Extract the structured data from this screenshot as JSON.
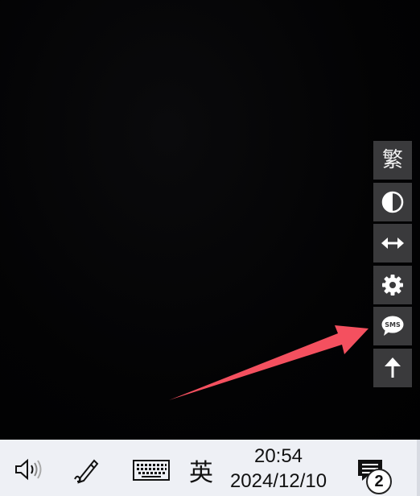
{
  "side_toolbar": {
    "items": [
      {
        "name": "traditional-chinese",
        "label": "繁",
        "icon": "traditional-chinese-icon"
      },
      {
        "name": "contrast",
        "icon": "contrast-icon"
      },
      {
        "name": "width-toggle",
        "icon": "horizontal-arrows-icon"
      },
      {
        "name": "settings",
        "icon": "gear-icon"
      },
      {
        "name": "sms",
        "label": "SMS",
        "icon": "sms-bubble-icon"
      },
      {
        "name": "back-to-top",
        "icon": "arrow-up-icon"
      }
    ]
  },
  "annotation": {
    "color": "#f4505f",
    "points_to": "sms"
  },
  "taskbar": {
    "background": "#eef0f5",
    "ime_label": "英",
    "clock_time": "20:54",
    "clock_date": "2024/12/10",
    "notification_count": "2",
    "icons": [
      "volume-icon",
      "pen-icon",
      "keyboard-icon",
      "notification-icon"
    ]
  }
}
